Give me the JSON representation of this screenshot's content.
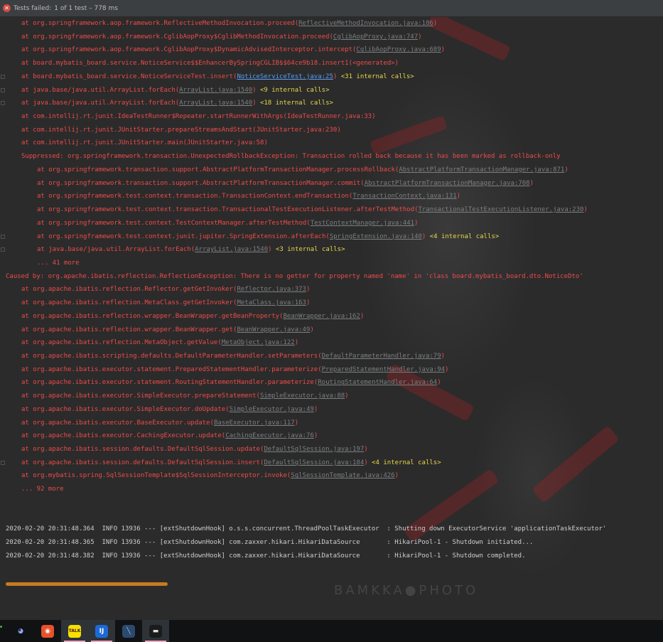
{
  "status": {
    "label": "Tests failed:",
    "detail": "1 of 1 test – 778 ms"
  },
  "console_lines": [
    {
      "indent": "ind1",
      "fold": false,
      "prefix": "at org.springframework.aop.framework.ReflectiveMethodInvocation.proceed(",
      "link": "ReflectiveMethodInvocation.java:186",
      "suffix": ")",
      "calls": ""
    },
    {
      "indent": "ind1",
      "fold": false,
      "prefix": "at org.springframework.aop.framework.CglibAopProxy$CglibMethodInvocation.proceed(",
      "link": "CglibAopProxy.java:747",
      "suffix": ")",
      "calls": ""
    },
    {
      "indent": "ind1",
      "fold": false,
      "prefix": "at org.springframework.aop.framework.CglibAopProxy$DynamicAdvisedInterceptor.intercept(",
      "link": "CglibAopProxy.java:689",
      "suffix": ")",
      "calls": ""
    },
    {
      "indent": "ind1",
      "fold": false,
      "prefix": "at board.mybatis_board.service.NoticeService$$EnhancerBySpringCGLIB$$64ce9b18.insert1(<generated>)",
      "link": "",
      "suffix": "",
      "calls": ""
    },
    {
      "indent": "ind1",
      "fold": true,
      "prefix": "at board.mybatis_board.service.NoticeServiceTest.insert(",
      "link": "NoticeServiceTest.java:25",
      "linkBright": true,
      "suffix": ") ",
      "calls": "<31 internal calls>"
    },
    {
      "indent": "ind1",
      "fold": true,
      "prefix": "at java.base/java.util.ArrayList.forEach(",
      "link": "ArrayList.java:1540",
      "suffix": ") ",
      "calls": "<9 internal calls>"
    },
    {
      "indent": "ind1",
      "fold": true,
      "prefix": "at java.base/java.util.ArrayList.forEach(",
      "link": "ArrayList.java:1540",
      "suffix": ") ",
      "calls": "<18 internal calls>"
    },
    {
      "indent": "ind1",
      "fold": false,
      "prefix": "at com.intellij.rt.junit.IdeaTestRunner$Repeater.startRunnerWithArgs(IdeaTestRunner.java:33)",
      "link": "",
      "suffix": "",
      "calls": ""
    },
    {
      "indent": "ind1",
      "fold": false,
      "prefix": "at com.intellij.rt.junit.JUnitStarter.prepareStreamsAndStart(JUnitStarter.java:230)",
      "link": "",
      "suffix": "",
      "calls": ""
    },
    {
      "indent": "ind1",
      "fold": false,
      "prefix": "at com.intellij.rt.junit.JUnitStarter.main(JUnitStarter.java:58)",
      "link": "",
      "suffix": "",
      "calls": ""
    },
    {
      "indent": "ind1",
      "fold": false,
      "prefix": "Suppressed: org.springframework.transaction.UnexpectedRollbackException: Transaction rolled back because it has been marked as rollback-only",
      "link": "",
      "suffix": "",
      "calls": ""
    },
    {
      "indent": "ind2",
      "fold": false,
      "prefix": "at org.springframework.transaction.support.AbstractPlatformTransactionManager.processRollback(",
      "link": "AbstractPlatformTransactionManager.java:871",
      "suffix": ")",
      "calls": ""
    },
    {
      "indent": "ind2",
      "fold": false,
      "prefix": "at org.springframework.transaction.support.AbstractPlatformTransactionManager.commit(",
      "link": "AbstractPlatformTransactionManager.java:708",
      "suffix": ")",
      "calls": ""
    },
    {
      "indent": "ind2",
      "fold": false,
      "prefix": "at org.springframework.test.context.transaction.TransactionContext.endTransaction(",
      "link": "TransactionContext.java:131",
      "suffix": ")",
      "calls": ""
    },
    {
      "indent": "ind2",
      "fold": false,
      "prefix": "at org.springframework.test.context.transaction.TransactionalTestExecutionListener.afterTestMethod(",
      "link": "TransactionalTestExecutionListener.java:230",
      "suffix": ")",
      "calls": ""
    },
    {
      "indent": "ind2",
      "fold": false,
      "prefix": "at org.springframework.test.context.TestContextManager.afterTestMethod(",
      "link": "TestContextManager.java:441",
      "suffix": ")",
      "calls": ""
    },
    {
      "indent": "ind2",
      "fold": true,
      "prefix": "at org.springframework.test.context.junit.jupiter.SpringExtension.afterEach(",
      "link": "SpringExtension.java:140",
      "suffix": ") ",
      "calls": "<4 internal calls>"
    },
    {
      "indent": "ind2",
      "fold": true,
      "prefix": "at java.base/java.util.ArrayList.forEach(",
      "link": "ArrayList.java:1540",
      "suffix": ") ",
      "calls": "<3 internal calls>"
    },
    {
      "indent": "ind2",
      "fold": false,
      "prefix": "... 41 more",
      "link": "",
      "suffix": "",
      "calls": ""
    },
    {
      "indent": "ind0",
      "fold": false,
      "prefix": "Caused by: org.apache.ibatis.reflection.ReflectionException: There is no getter for property named 'name' in 'class board.mybatis_board.dto.NoticeDto'",
      "link": "",
      "suffix": "",
      "calls": ""
    },
    {
      "indent": "ind1",
      "fold": false,
      "prefix": "at org.apache.ibatis.reflection.Reflector.getGetInvoker(",
      "link": "Reflector.java:373",
      "suffix": ")",
      "calls": ""
    },
    {
      "indent": "ind1",
      "fold": false,
      "prefix": "at org.apache.ibatis.reflection.MetaClass.getGetInvoker(",
      "link": "MetaClass.java:163",
      "suffix": ")",
      "calls": ""
    },
    {
      "indent": "ind1",
      "fold": false,
      "prefix": "at org.apache.ibatis.reflection.wrapper.BeanWrapper.getBeanProperty(",
      "link": "BeanWrapper.java:162",
      "suffix": ")",
      "calls": ""
    },
    {
      "indent": "ind1",
      "fold": false,
      "prefix": "at org.apache.ibatis.reflection.wrapper.BeanWrapper.get(",
      "link": "BeanWrapper.java:49",
      "suffix": ")",
      "calls": ""
    },
    {
      "indent": "ind1",
      "fold": false,
      "prefix": "at org.apache.ibatis.reflection.MetaObject.getValue(",
      "link": "MetaObject.java:122",
      "suffix": ")",
      "calls": ""
    },
    {
      "indent": "ind1",
      "fold": false,
      "prefix": "at org.apache.ibatis.scripting.defaults.DefaultParameterHandler.setParameters(",
      "link": "DefaultParameterHandler.java:79",
      "suffix": ")",
      "calls": ""
    },
    {
      "indent": "ind1",
      "fold": false,
      "prefix": "at org.apache.ibatis.executor.statement.PreparedStatementHandler.parameterize(",
      "link": "PreparedStatementHandler.java:94",
      "suffix": ")",
      "calls": ""
    },
    {
      "indent": "ind1",
      "fold": false,
      "prefix": "at org.apache.ibatis.executor.statement.RoutingStatementHandler.parameterize(",
      "link": "RoutingStatementHandler.java:64",
      "suffix": ")",
      "calls": ""
    },
    {
      "indent": "ind1",
      "fold": false,
      "prefix": "at org.apache.ibatis.executor.SimpleExecutor.prepareStatement(",
      "link": "SimpleExecutor.java:88",
      "suffix": ")",
      "calls": ""
    },
    {
      "indent": "ind1",
      "fold": false,
      "prefix": "at org.apache.ibatis.executor.SimpleExecutor.doUpdate(",
      "link": "SimpleExecutor.java:49",
      "suffix": ")",
      "calls": ""
    },
    {
      "indent": "ind1",
      "fold": false,
      "prefix": "at org.apache.ibatis.executor.BaseExecutor.update(",
      "link": "BaseExecutor.java:117",
      "suffix": ")",
      "calls": ""
    },
    {
      "indent": "ind1",
      "fold": false,
      "prefix": "at org.apache.ibatis.executor.CachingExecutor.update(",
      "link": "CachingExecutor.java:76",
      "suffix": ")",
      "calls": ""
    },
    {
      "indent": "ind1",
      "fold": false,
      "prefix": "at org.apache.ibatis.session.defaults.DefaultSqlSession.update(",
      "link": "DefaultSqlSession.java:197",
      "suffix": ")",
      "calls": ""
    },
    {
      "indent": "ind1",
      "fold": true,
      "prefix": "at org.apache.ibatis.session.defaults.DefaultSqlSession.insert(",
      "link": "DefaultSqlSession.java:184",
      "suffix": ") ",
      "calls": "<4 internal calls>"
    },
    {
      "indent": "ind1",
      "fold": false,
      "prefix": "at org.mybatis.spring.SqlSessionTemplate$SqlSessionInterceptor.invoke(",
      "link": "SqlSessionTemplate.java:426",
      "suffix": ")",
      "calls": ""
    },
    {
      "indent": "ind1",
      "fold": false,
      "prefix": "... 92 more",
      "link": "",
      "suffix": "",
      "calls": ""
    }
  ],
  "log_lines": [
    "2020-02-20 20:31:48.364  INFO 13936 --- [extShutdownHook] o.s.s.concurrent.ThreadPoolTaskExecutor  : Shutting down ExecutorService 'applicationTaskExecutor'",
    "2020-02-20 20:31:48.365  INFO 13936 --- [extShutdownHook] com.zaxxer.hikari.HikariDataSource       : HikariPool-1 - Shutdown initiated...",
    "2020-02-20 20:31:48.382  INFO 13936 --- [extShutdownHook] com.zaxxer.hikari.HikariDataSource       : HikariPool-1 - Shutdown completed."
  ],
  "watermark": "BAMKKA●PHOTO",
  "taskbar": {
    "apps": [
      {
        "name": "discord-icon",
        "glyph": "◕",
        "bg": "#101214",
        "fg": "#8fa3ff",
        "active": false
      },
      {
        "name": "browser-icon",
        "glyph": "◉",
        "bg": "#e8512a",
        "fg": "#ffffff",
        "active": false
      },
      {
        "name": "kakaotalk-icon",
        "glyph": "TALK",
        "bg": "#f9e000",
        "fg": "#3b1e1e",
        "active": true
      },
      {
        "name": "intellij-icon",
        "glyph": "IJ",
        "bg": "#1d6ad6",
        "fg": "#ffffff",
        "active": true
      },
      {
        "name": "database-icon",
        "glyph": "╲",
        "bg": "#2c4a6e",
        "fg": "#9fc4ff",
        "active": false
      },
      {
        "name": "screenshot-icon",
        "glyph": "▬",
        "bg": "#1b1b1b",
        "fg": "#e0e0e0",
        "active": true
      }
    ]
  },
  "colors": {
    "error": "#ef4b4b",
    "link": "#7c7f82",
    "calls": "#e7d84b",
    "scroll": "#c77a1e"
  }
}
